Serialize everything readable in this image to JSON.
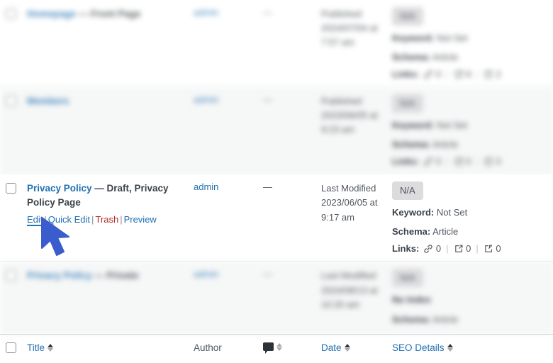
{
  "table": {
    "rows": [
      {
        "blurred": true,
        "alt": false,
        "title": "Homepage",
        "state": "— Front Page",
        "author": "admin",
        "comments": "—",
        "date_label": "Published",
        "date_value": "2024/07/04 at",
        "date_time": "7:57 am",
        "seo_badge": "N/A",
        "keyword_label": "Keyword:",
        "keyword_value": "Not Set",
        "schema_label": "Schema:",
        "schema_value": "Article",
        "links_label": "Links:",
        "links_internal": "0",
        "links_external": "9",
        "links_inbound": "2",
        "actions": []
      },
      {
        "blurred": true,
        "alt": true,
        "title": "Members",
        "state": "",
        "author": "admin",
        "comments": "—",
        "date_label": "Published",
        "date_value": "2023/06/05 at",
        "date_time": "9:23 am",
        "seo_badge": "N/A",
        "keyword_label": "Keyword:",
        "keyword_value": "Not Set",
        "schema_label": "Schema:",
        "schema_value": "Article",
        "links_label": "Links:",
        "links_internal": "0",
        "links_external": "0",
        "links_inbound": "0",
        "actions": []
      },
      {
        "blurred": false,
        "alt": false,
        "title": "Privacy Policy",
        "state": "— Draft, Privacy Policy Page",
        "author": "admin",
        "comments": "—",
        "date_label": "Last Modified",
        "date_value": "2023/06/05 at",
        "date_time": "9:17 am",
        "seo_badge": "N/A",
        "keyword_label": "Keyword:",
        "keyword_value": "Not Set",
        "schema_label": "Schema:",
        "schema_value": "Article",
        "links_label": "Links:",
        "links_internal": "0",
        "links_external": "0",
        "links_inbound": "0",
        "actions": [
          {
            "label": "Edit",
            "kind": "edit",
            "hovered": true
          },
          {
            "label": "Quick Edit",
            "kind": "quick-edit",
            "hovered": false
          },
          {
            "label": "Trash",
            "kind": "trash",
            "hovered": false
          },
          {
            "label": "Preview",
            "kind": "preview",
            "hovered": false
          }
        ]
      },
      {
        "blurred": true,
        "alt": true,
        "title": "Privacy Policy",
        "state": "— Private",
        "author": "admin",
        "comments": "—",
        "date_label": "Last Modified",
        "date_value": "2024/08/13 at",
        "date_time": "10:20 am",
        "seo_badge": "N/A",
        "noindex_label": "No Index",
        "schema_label": "Schema:",
        "schema_value": "Article",
        "actions": []
      }
    ],
    "footer_headers": {
      "title": "Title",
      "author": "Author",
      "comments_icon": "comment-bubble-icon",
      "date": "Date",
      "seo_details": "SEO Details"
    }
  },
  "colors": {
    "link": "#2271b1",
    "trash": "#b32d2e",
    "text": "#3c434a",
    "muted": "#50575e",
    "row_alt_bg": "#f6f7f7",
    "badge_bg": "#dcdcde",
    "cursor": "#3a5ccc"
  }
}
